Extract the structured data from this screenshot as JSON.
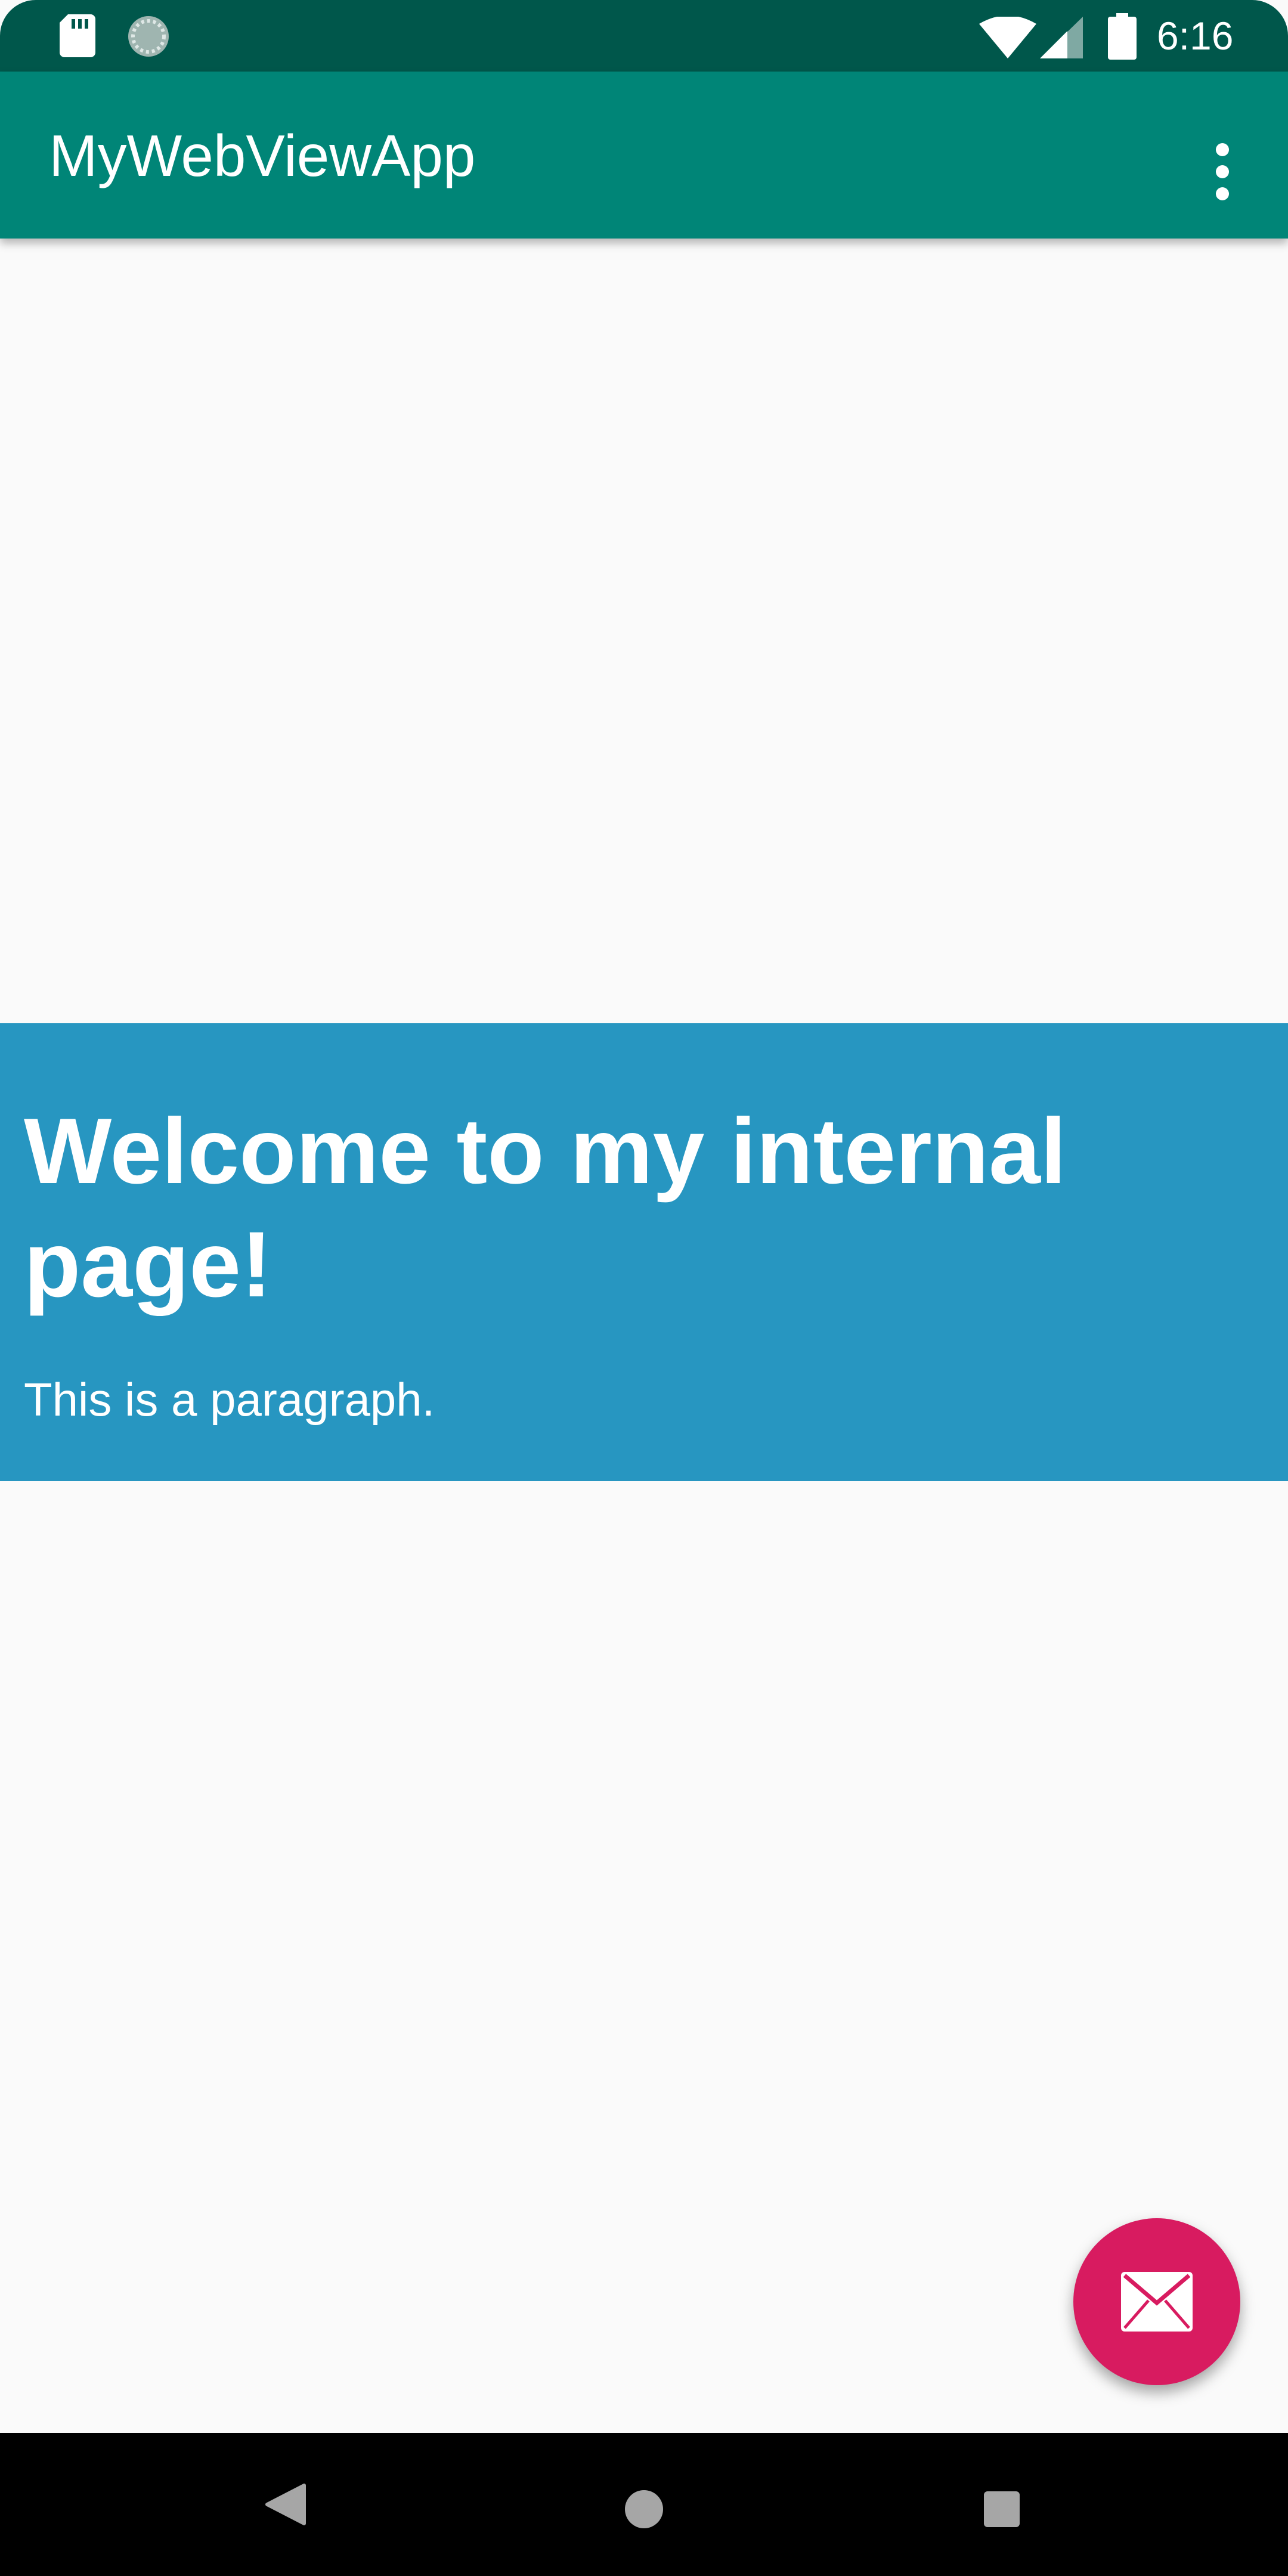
{
  "status_bar": {
    "time": "6:16",
    "icons": [
      "sd-card-icon",
      "sync-icon",
      "wifi-icon",
      "cell-signal-icon",
      "battery-icon"
    ]
  },
  "app_bar": {
    "title": "MyWebViewApp",
    "overflow_icon": "more-vert-icon"
  },
  "webview": {
    "heading": "Welcome to my internal page!",
    "paragraph": "This is a paragraph."
  },
  "fab": {
    "icon": "mail-icon"
  },
  "nav_bar": {
    "buttons": [
      "back-icon",
      "home-icon",
      "recents-icon"
    ]
  },
  "colors": {
    "status_bar": "#00574b",
    "app_bar": "#008577",
    "banner": "#2796c1",
    "fab": "#d81b60",
    "page_background": "#fafafa",
    "nav_bar": "#000000"
  }
}
